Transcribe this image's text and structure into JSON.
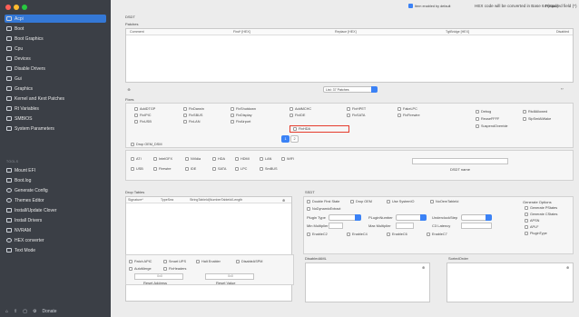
{
  "sidebar": {
    "items": [
      {
        "label": "Acpi"
      },
      {
        "label": "Boot"
      },
      {
        "label": "Boot Graphics"
      },
      {
        "label": "Cpu"
      },
      {
        "label": "Devices"
      },
      {
        "label": "Disable Drivers"
      },
      {
        "label": "Gui"
      },
      {
        "label": "Graphics"
      },
      {
        "label": "Kernel and Kext Patches"
      },
      {
        "label": "Rt Variables"
      },
      {
        "label": "SMBIOS"
      },
      {
        "label": "System Parameters"
      }
    ],
    "tools_header": "TOOLS",
    "tools": [
      {
        "label": "Mount EFI"
      },
      {
        "label": "Boot.log"
      },
      {
        "label": "Generate Config"
      },
      {
        "label": "Themes Editor"
      },
      {
        "label": "Install/Update Clover"
      },
      {
        "label": "Install Drivers"
      },
      {
        "label": "NVRAM"
      },
      {
        "label": "HEX converter"
      },
      {
        "label": "Text Mode"
      }
    ],
    "bottom_label": "Donate"
  },
  "topbar": {
    "checkbox_label": "Item enabled by default",
    "hex_note": "HEX code will be converted in Base 64 (mac)",
    "required": "Required field (*)"
  },
  "dsdt": {
    "header": "DSDT",
    "patches_label": "Patches",
    "columns": [
      "Comment",
      "Find* [HEX]",
      "Replace [HEX]",
      "TgtBridge [HEX]",
      "Disabled"
    ],
    "list_label": "List: 37 Patches"
  },
  "fixes": {
    "header": "Fixes",
    "items": [
      [
        "AddDTGP",
        "FixDarwin",
        "FixShutdown",
        "AddMCHC",
        "FixHPET",
        "FakeLPC"
      ],
      [
        "FixIPIC",
        "FixSBUS",
        "FixDisplay",
        "FixIDE",
        "FixSATA",
        "FixFirewire"
      ],
      [
        "FixUSB",
        "FixLAN",
        "FixAirport",
        "FixHDA",
        "",
        ""
      ]
    ],
    "right_items": [
      "Debug",
      "ReuseFFFF",
      "SuspendOverride"
    ],
    "right_items2": [
      "Rtc8Allowed",
      "SlpSmiAtWake"
    ],
    "pages": [
      "1",
      "2"
    ],
    "drop_label": "Drop OEM_DSM",
    "devices": [
      "ATI",
      "IntelGFX",
      "NVidia",
      "HDA",
      "HDMI",
      "LAN",
      "WIFI"
    ],
    "devices2": [
      "USB",
      "Firewire",
      "IDE",
      "SATA",
      "LPC",
      "SmBUS"
    ],
    "dsdt_name_label": "DSDT name"
  },
  "drop_tables": {
    "header": "Drop Tables",
    "columns": [
      "Signature*",
      "TypeSea",
      "StringTableId|NumberTableId/Length"
    ]
  },
  "ssdt": {
    "header": "SSDT",
    "options": [
      "Double First State",
      "Drop OEM",
      "Use SystemIO",
      "NoOemTableId"
    ],
    "options2": [
      "NoDynamicExtract"
    ],
    "plugin_type_label": "Plugin Type",
    "min_multiplier_label": "Min Multiplier",
    "max_multiplier_label": "Max Multiplier",
    "c3_latency_label": "C3 Latency",
    "pluginnumber_label": "PLuginNumber",
    "underclock_label": "UnderclockStep",
    "enable": [
      "EnableC2",
      "EnableC4",
      "EnableC6",
      "EnableC7"
    ],
    "generate_header": "Generate Options",
    "generate": [
      "Generate PStates",
      "Generate CStates",
      "APSN",
      "APLF",
      "PluginType"
    ]
  },
  "bottom": {
    "checks": [
      "Patch APIC",
      "Smart UPS",
      "Halt Enabler",
      "DisableASPM"
    ],
    "checks2": [
      "AutoMerge",
      "FixHeaders"
    ],
    "reset_address": "Reset Address",
    "reset_value": "Reset Value",
    "addr_placeholder": "0x0",
    "val_placeholder": "0x0",
    "disabled_aml": "DisabledAML",
    "sorted_order": "SortedOrder"
  },
  "colors": {
    "accent": "#3478d6",
    "sidebar": "#3b3f46",
    "highlight": "#e53b2c"
  }
}
